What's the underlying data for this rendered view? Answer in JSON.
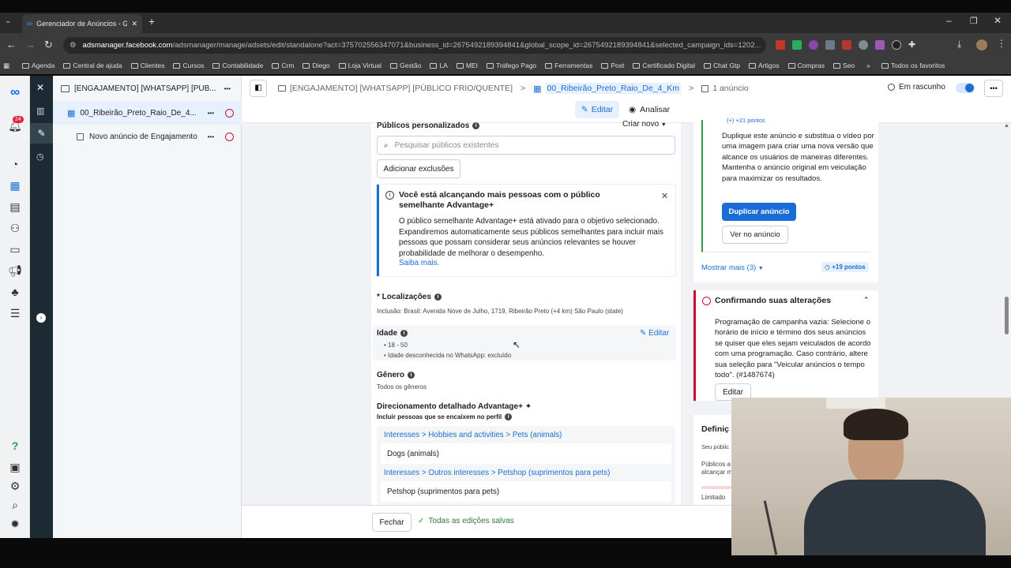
{
  "browser": {
    "tab_title": "Gerenciador de Anúncios - Gere",
    "url_domain": "adsmanager.facebook.com",
    "url_path": "/adsmanager/manage/adsets/edit/standalone?act=375702556347071&business_id=2675492189394841&global_scope_id=2675492189394841&selected_campaign_ids=1202...",
    "bookmarks": [
      "Agenda",
      "Central de ajuda",
      "Clientes",
      "Cursos",
      "Contabilidade",
      "Crm",
      "Diego",
      "Loja Virtual",
      "Gestão",
      "LA",
      "MEI",
      "Tráfego Pago",
      "Ferramentas",
      "Post",
      "Certificado Digital",
      "Chat Gtp",
      "Artigos",
      "Compras",
      "Seo"
    ],
    "all_favorites": "Todos os favoritos",
    "more": "»"
  },
  "rail": {
    "notif_count": "24"
  },
  "tree": {
    "campaign": "[ENGAJAMENTO] [WHATSAPP] [PÚB...",
    "adset": "00_Ribeirão_Preto_Raio_De_4...",
    "ad": "Novo anúncio de Engajamento",
    "more": "•••"
  },
  "header": {
    "crumb_campaign": "[ENGAJAMENTO] [WHATSAPP] [PÚBLICO FRIO/QUENTE]",
    "crumb_adset": "00_Ribeirão_Preto_Raio_De_4_Km",
    "crumb_ads": "1 anúncio",
    "status": "Em rascunho",
    "edit_label": "Editar",
    "review_label": "Analisar",
    "sep": ">"
  },
  "form": {
    "custom_audiences": "Públicos personalizados",
    "create_new": "Criar novo",
    "search_placeholder": "Pesquisar públicos existentes",
    "add_exclusions": "Adicionar exclusões",
    "notice_title": "Você está alcançando mais pessoas com o público semelhante Advantage+",
    "notice_body": "O público semelhante Advantage+ está ativado para o objetivo selecionado. Expandiremos automaticamente seus públicos semelhantes para incluir mais pessoas que possam considerar seus anúncios relevantes se houver probabilidade de melhorar o desempenho.",
    "learn_more": "Saiba mais.",
    "locations_label": "* Localizações",
    "locations_value": "Inclusão: Brasil: Avenida Nove de Julho, 1719, Ribeirão Preto (+4 km) São Paulo (state)",
    "age_label": "Idade",
    "age_edit": "Editar",
    "age_range": "18 - 50",
    "age_unknown": "Idade desconhecida no WhatsApp: excluído",
    "gender_label": "Gênero",
    "gender_value": "Todos os gêneros",
    "detailed_label": "Direcionamento detalhado Advantage+",
    "detailed_plus": "✦",
    "include_label": "Incluir pessoas que se encaixem no perfil",
    "interest1_path": "Interesses > Hobbies and activities > Pets (animals)",
    "interest1_item": "Dogs (animals)",
    "interest2_path": "Interesses > Outros interesses > Petshop (suprimentos para pets)",
    "interest2_item": "Petshop (suprimentos para pets)"
  },
  "right": {
    "points_top": "(+) +21 pontos",
    "dup_text": "Duplique este anúncio e substitua o vídeo por uma imagem para criar uma nova versão que alcance os usuários de maneiras diferentes. Mantenha o anúncio original em veiculação para maximizar os resultados.",
    "dup_button": "Duplicar anúncio",
    "view_button": "Ver no anúncio",
    "show_more": "Mostrar mais (3)",
    "points": "+19 pontos",
    "confirm_title": "Confirmando suas alterações",
    "confirm_body": "Programação de campanha vazia: Selecione o horário de início e término dos seus anúncios se quiser que eles sejam veiculados de acordo com uma programação. Caso contrário, altere sua seleção para \"Veicular anúncios o tempo todo\". (#1487674)",
    "confirm_edit": "Editar",
    "def_title": "Definiç",
    "def_line1": "Seu públic",
    "def_line2": "Públicos a",
    "def_line3": "alcançar m",
    "def_limit": "Limitado"
  },
  "footer": {
    "close": "Fechar",
    "saved": "Todas as edições salvas"
  },
  "colors": {
    "accent": "#1a6dd4",
    "dark": "#1c2b33",
    "green": "#2e9b4a",
    "red": "#c8102e"
  }
}
